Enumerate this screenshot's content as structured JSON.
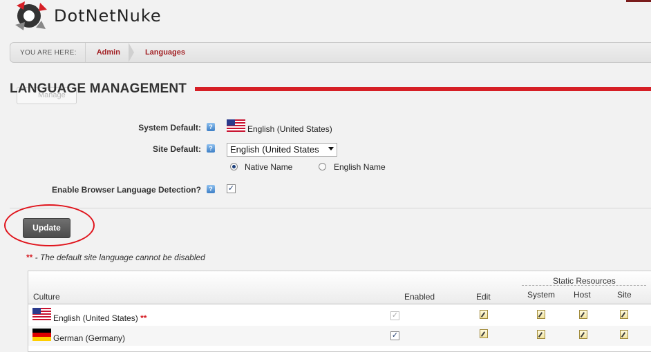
{
  "brand": {
    "logo_text": "DotNetNuke"
  },
  "breadcrumb": {
    "prefix": "YOU ARE HERE:",
    "items": [
      "Admin",
      "Languages"
    ]
  },
  "page": {
    "title": "LANGUAGE MANAGEMENT",
    "manage_label": "Manage"
  },
  "form": {
    "system_default_label": "System Default:",
    "system_default_value": "English (United States)",
    "site_default_label": "Site Default:",
    "site_default_value": "English (United States",
    "radio_native": "Native Name",
    "radio_english": "English Name",
    "radio_selected": "Native Name",
    "browser_detect_label": "Enable Browser Language Detection?",
    "browser_detect_checked": true,
    "help_glyph": "?"
  },
  "actions": {
    "update_label": "Update"
  },
  "note": {
    "stars": "**",
    "text": " - The default site language cannot be disabled"
  },
  "table": {
    "headers": {
      "culture": "Culture",
      "enabled": "Enabled",
      "edit": "Edit",
      "static_resources": "Static Resources",
      "system": "System",
      "host": "Host",
      "site": "Site"
    },
    "rows": [
      {
        "culture": "English (United States)",
        "marker": "**",
        "flag": "us-flag-icon",
        "enabled": true,
        "enabled_disabled": true
      },
      {
        "culture": "German (Germany)",
        "marker": "",
        "flag": "de-flag-icon",
        "enabled": true,
        "enabled_disabled": false
      }
    ]
  },
  "colors": {
    "accent": "#d61f26",
    "crumb": "#a22024",
    "button": "#5a5a5a"
  }
}
